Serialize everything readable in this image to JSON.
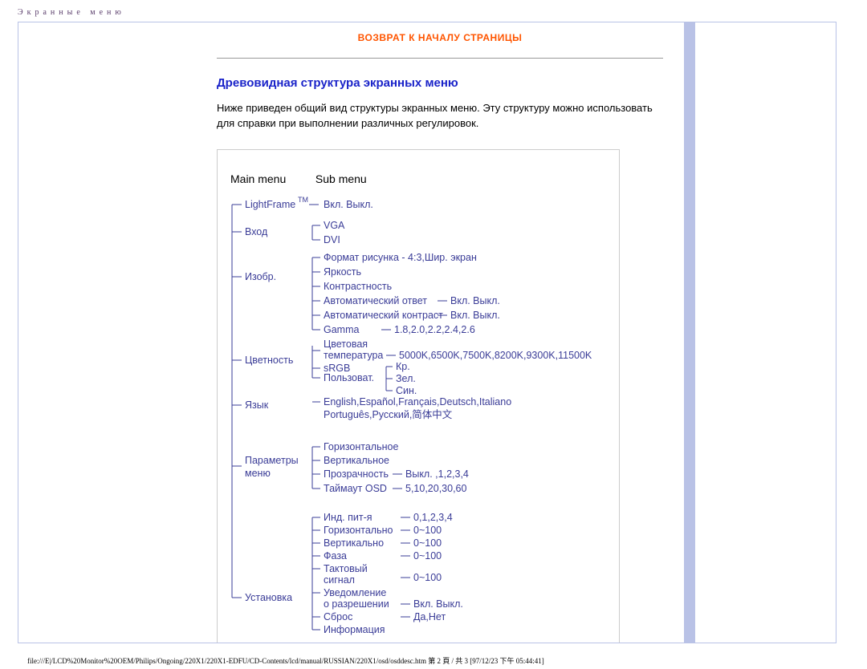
{
  "page_header": "Экранные меню",
  "top_link": "ВОЗВРАТ К НАЧАЛУ СТРАНИЦЫ",
  "heading": "Древовидная структура экранных меню",
  "paragraph": "Ниже приведен общий вид структуры экранных меню. Эту структуру можно использовать для справки при выполнении различных регулировок.",
  "columns": {
    "main": "Main menu",
    "sub": "Sub menu"
  },
  "tree": {
    "lightframe": {
      "label": "LightFrame",
      "tm": "TM",
      "sub": "Вкл. Выкл."
    },
    "input": {
      "label": "Вход",
      "opts": [
        "VGA",
        "DVI"
      ]
    },
    "image": {
      "label": "Изобр.",
      "format": "Формат рисунка - 4:3,Шир. экран",
      "brightness": "Яркость",
      "contrast": "Контрастность",
      "auto_answer": "Автоматический  ответ",
      "auto_answer_val": "Вкл. Выкл.",
      "auto_contrast": "Автоматический контраст",
      "auto_contrast_val": "Вкл. Выкл.",
      "gamma": "Gamma",
      "gamma_val": "1.8,2.0,2.2,2.4,2.6"
    },
    "color": {
      "label": "Цветность",
      "temp": "Цветовая температура",
      "temp_val": "5000K,6500K,7500K,8200K,9300K,11500K",
      "srgb": "sRGB",
      "custom": "Пользоват.",
      "custom_r": "Кр.",
      "custom_g": "Зел.",
      "custom_b": "Син."
    },
    "language": {
      "label": "Язык",
      "line1": "English,Español,Français,Deutsch,Italiano",
      "line2": "Português,Русский,简体中文"
    },
    "osd": {
      "label1": "Параметры",
      "label2": "меню",
      "horiz": "Горизонтальное",
      "vert": "Вертикальное",
      "transp": "Прозрачность",
      "transp_val": "Выкл. ,1,2,3,4",
      "timeout": "Таймаут OSD",
      "timeout_val": "5,10,20,30,60"
    },
    "setup": {
      "label": "Установка",
      "power": "Инд. пит-я",
      "power_val": "0,1,2,3,4",
      "horiz": "Горизонтально",
      "horiz_val": "0~100",
      "vert": "Вертикально",
      "vert_val": "0~100",
      "phase": "Фаза",
      "phase_val": "0~100",
      "clock1": "Тактовый",
      "clock2": "сигнал",
      "clock_val": "0~100",
      "res1": "Уведомление",
      "res2": "о  разрешении",
      "res_val": "Вкл. Выкл.",
      "reset": "Сброс",
      "reset_val": "Да,Нет",
      "info": "Информация"
    }
  },
  "footer": "file:///E|/LCD%20Monitor%20OEM/Philips/Ongoing/220X1/220X1-EDFU/CD-Contents/lcd/manual/RUSSIAN/220X1/osd/osddesc.htm 第 2 頁 / 共 3  [97/12/23 下午 05:44:41]"
}
